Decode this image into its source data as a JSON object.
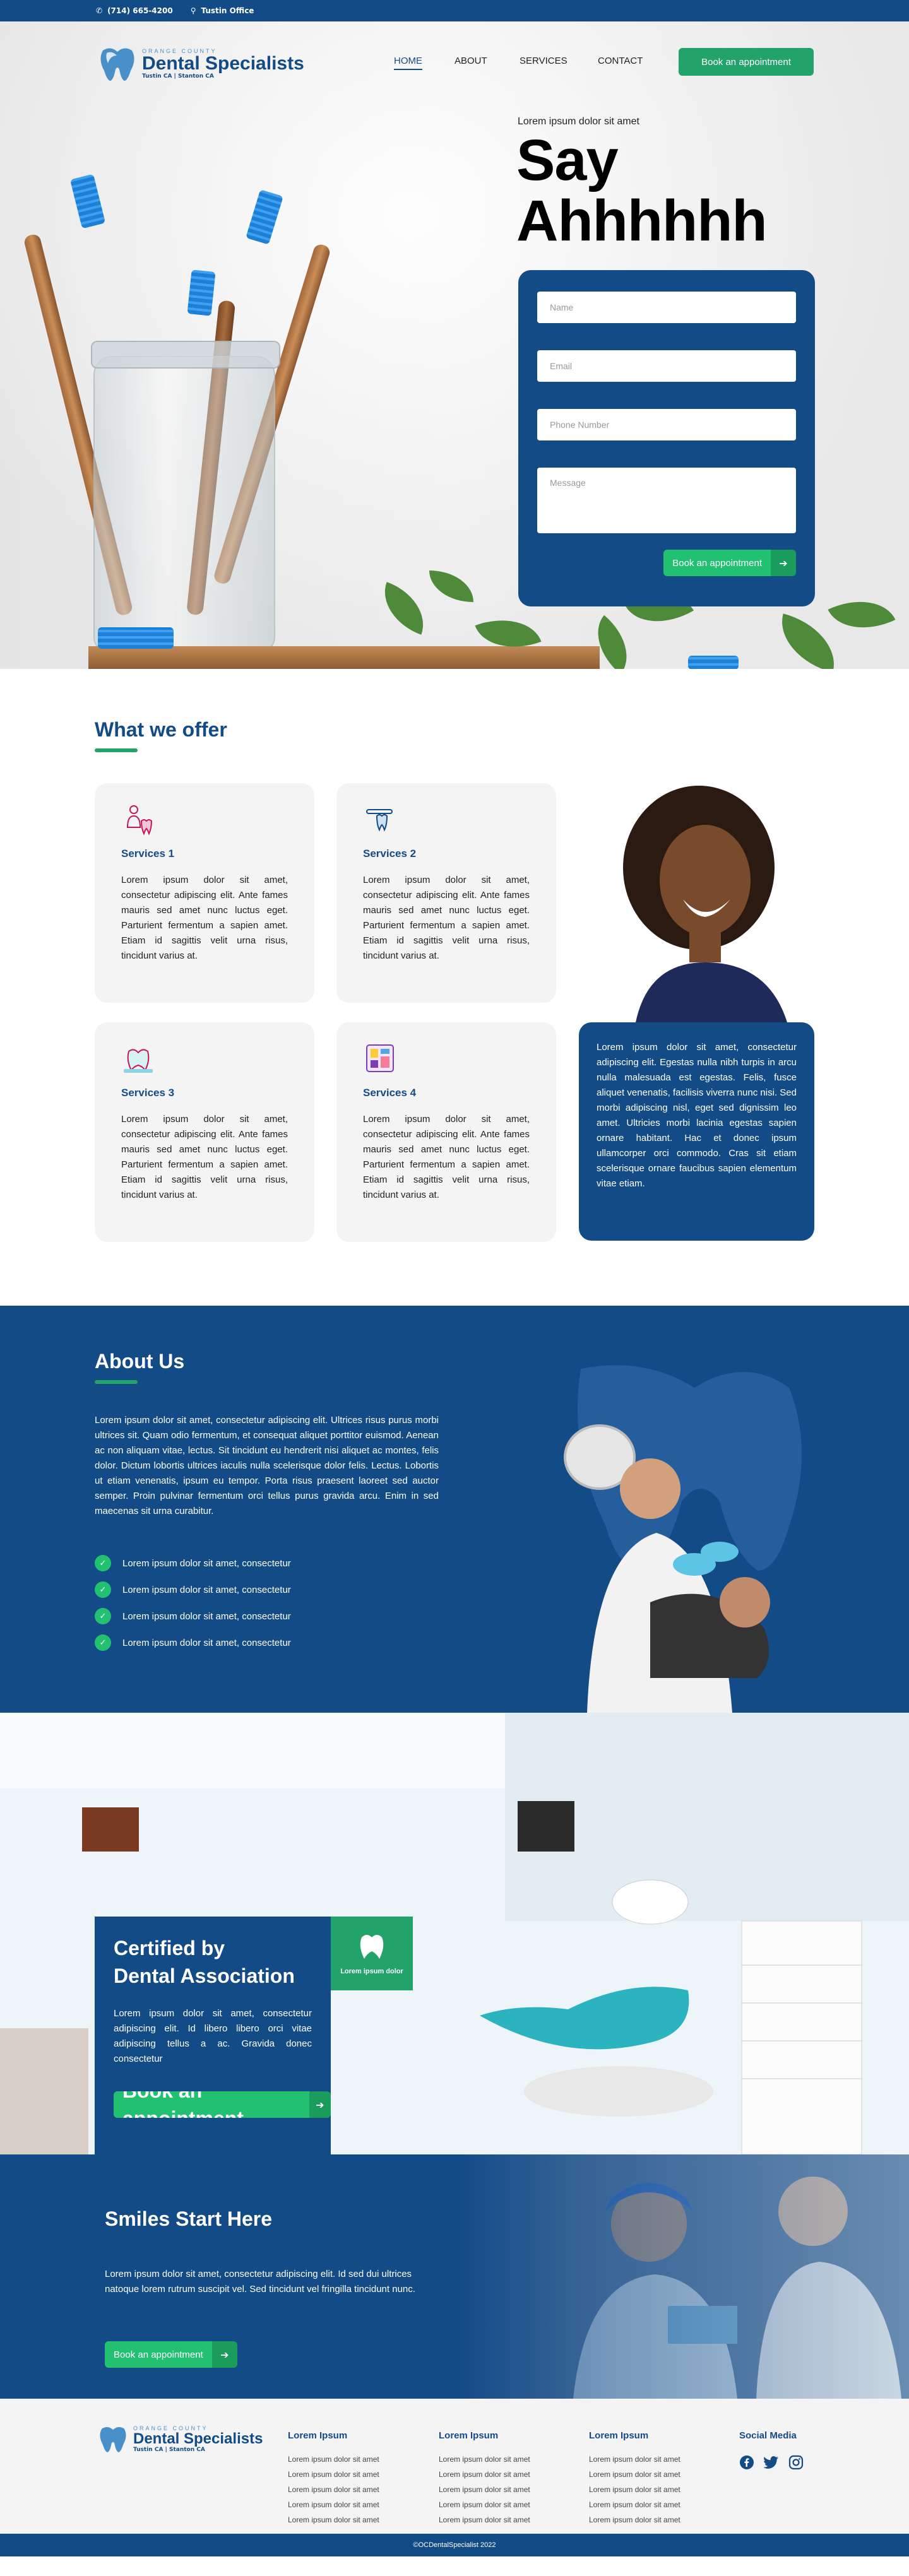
{
  "topbar": {
    "phone": "(714) 665-4200",
    "location": "Tustin Office"
  },
  "logo": {
    "small": "ORANGE COUNTY",
    "name": "Dental Specialists",
    "sub": "Tustin CA | Stanton CA"
  },
  "nav": {
    "items": [
      "HOME",
      "ABOUT",
      "SERVICES",
      "CONTACT"
    ],
    "cta": "Book an appointment"
  },
  "hero": {
    "kicker": "Lorem ipsum dolor sit amet",
    "title_line1": "Say",
    "title_line2": "Ahhhhhh",
    "form": {
      "name": "Name",
      "email": "Email",
      "phone": "Phone Number",
      "message": "Message",
      "button": "Book an appointment"
    }
  },
  "offer": {
    "heading": "What we offer",
    "cards": [
      {
        "title": "Services 1",
        "body": "Lorem ipsum dolor sit amet, consectetur adipiscing elit. Ante fames mauris sed amet nunc luctus eget. Parturient fermentum a sapien amet. Etiam id sagittis velit urna risus, tincidunt varius at."
      },
      {
        "title": "Services 2",
        "body": "Lorem ipsum dolor sit amet, consectetur adipiscing elit. Ante fames mauris sed amet nunc luctus eget. Parturient fermentum a sapien amet. Etiam id sagittis velit urna risus, tincidunt varius at."
      },
      {
        "title": "Services 3",
        "body": "Lorem ipsum dolor sit amet, consectetur adipiscing elit. Ante fames mauris sed amet nunc luctus eget. Parturient fermentum a sapien amet. Etiam id sagittis velit urna risus, tincidunt varius at."
      },
      {
        "title": "Services 4",
        "body": "Lorem ipsum dolor sit amet, consectetur adipiscing elit. Ante fames mauris sed amet nunc luctus eget. Parturient fermentum a sapien amet. Etiam id sagittis velit urna risus, tincidunt varius at."
      }
    ],
    "blue_card": "Lorem ipsum dolor sit amet, consectetur adipiscing elit. Egestas nulla nibh turpis in arcu nulla malesuada est egestas. Felis, fusce aliquet venenatis, facilisis viverra nunc nisi. Sed morbi adipiscing nisl, eget sed dignissim leo amet. Ultricies morbi lacinia egestas sapien ornare habitant. Hac et donec ipsum ullamcorper orci commodo. Cras sit etiam scelerisque ornare faucibus sapien elementum vitae etiam."
  },
  "about": {
    "heading": "About Us",
    "body": "Lorem ipsum dolor sit amet, consectetur adipiscing elit. Ultrices risus purus morbi ultrices sit. Quam odio fermentum, et consequat aliquet porttitor euismod. Aenean ac non aliquam vitae, lectus. Sit tincidunt eu hendrerit nisi aliquet ac montes, felis dolor. Dictum lobortis ultrices iaculis nulla scelerisque dolor felis. Lectus. Lobortis ut etiam venenatis, ipsum eu tempor. Porta risus praesent laoreet sed auctor semper. Proin pulvinar fermentum orci tellus purus gravida arcu. Enim in sed maecenas sit urna curabitur.",
    "checks": [
      "Lorem ipsum dolor sit amet, consectetur",
      "Lorem ipsum dolor sit amet, consectetur",
      "Lorem ipsum dolor sit amet, consectetur",
      "Lorem ipsum dolor sit amet, consectetur"
    ]
  },
  "certified": {
    "title_line1": "Certified by",
    "title_line2": "Dental Association",
    "body": "Lorem ipsum dolor sit amet, consectetur adipiscing elit. Id libero libero orci vitae adipiscing tellus a ac. Gravida donec consectetur",
    "button": "Book an appointment",
    "badge": "Lorem ipsum dolor"
  },
  "smiles": {
    "heading": "Smiles Start Here",
    "body": "Lorem ipsum dolor sit amet, consectetur adipiscing elit. Id sed dui ultrices natoque lorem rutrum suscipit vel. Sed tincidunt vel fringilla tincidunt nunc.",
    "button": "Book an appointment"
  },
  "footer": {
    "columns": [
      {
        "title": "Lorem Ipsum",
        "links": [
          "Lorem ipsum dolor sit amet",
          "Lorem ipsum dolor sit amet",
          "Lorem ipsum dolor sit amet",
          "Lorem ipsum dolor sit amet",
          "Lorem ipsum dolor sit amet"
        ]
      },
      {
        "title": "Lorem Ipsum",
        "links": [
          "Lorem ipsum dolor sit amet",
          "Lorem ipsum dolor sit amet",
          "Lorem ipsum dolor sit amet",
          "Lorem ipsum dolor sit amet",
          "Lorem ipsum dolor sit amet"
        ]
      },
      {
        "title": "Lorem Ipsum",
        "links": [
          "Lorem ipsum dolor sit amet",
          "Lorem ipsum dolor sit amet",
          "Lorem ipsum dolor sit amet",
          "Lorem ipsum dolor sit amet",
          "Lorem ipsum dolor sit amet"
        ]
      }
    ],
    "social_title": "Social Media",
    "social": [
      "facebook-icon",
      "twitter-icon",
      "instagram-icon"
    ],
    "copyright": "©OCDentalSpecialist 2022"
  },
  "colors": {
    "brand_blue": "#134b87",
    "brand_green": "#22a36a"
  }
}
